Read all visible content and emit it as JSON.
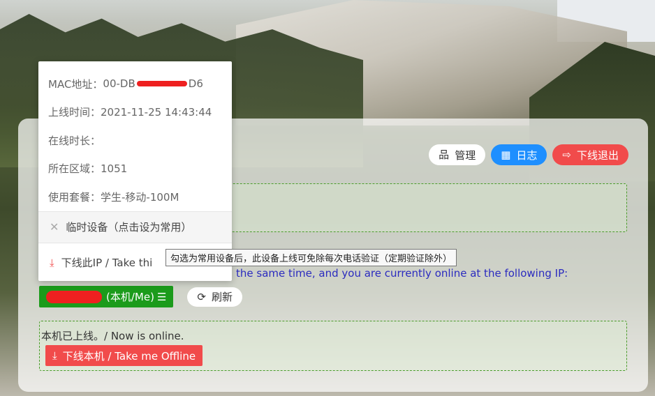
{
  "header": {
    "manage_label": "管理",
    "log_label": "日志",
    "logout_label": "下线退出"
  },
  "popover": {
    "mac_label": "MAC地址：",
    "mac_prefix": "00-DB",
    "mac_suffix": "D6",
    "online_time": "上线时间：2021-11-25 14:43:44",
    "duration": "在线时长：",
    "area": "所在区域：1051",
    "plan": "使用套餐：学生-移动-100M",
    "temp_device": "临时设备（点击设为常用）",
    "offline_ip": "下线此IP / Take thi"
  },
  "tooltip": "勾选为常用设备后，此设备上线可免除每次电话验证（定期验证除外）",
  "main": {
    "info_text": "the same time, and you are currently online at the following IP:",
    "ip_suffix": "(本机/Me)",
    "refresh_label": "刷新",
    "online_status": "本机已上线。/ Now is online.",
    "offline_me_label": "下线本机 / Take me Offline"
  },
  "colors": {
    "accent_blue": "#1e8fff",
    "danger_red": "#f14b4b",
    "success_green": "#1b9b1b"
  }
}
